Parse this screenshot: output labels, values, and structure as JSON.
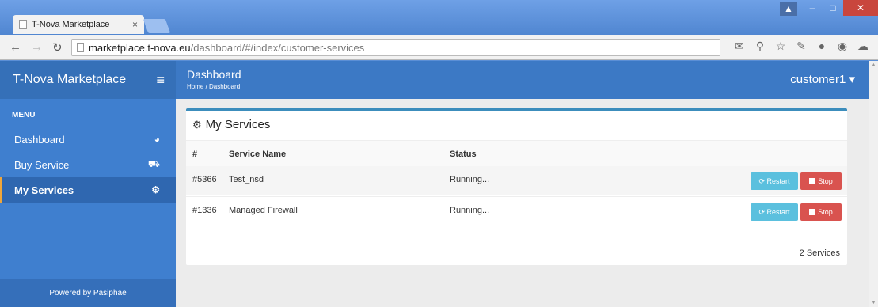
{
  "browser": {
    "tab_title": "T-Nova Marketplace",
    "tab_close": "×",
    "url_host": "marketplace.t-nova.eu",
    "url_path": "/dashboard/#/index/customer-services"
  },
  "app": {
    "brand": "T-Nova Marketplace",
    "header_title": "Dashboard",
    "breadcrumb": "Home / Dashboard",
    "user": "customer1 ▾"
  },
  "sidebar": {
    "menu_header": "MENU",
    "items": [
      {
        "label": "Dashboard",
        "icon": "dashboard-icon"
      },
      {
        "label": "Buy Service",
        "icon": "cart-icon"
      },
      {
        "label": "My Services",
        "icon": "gears-icon"
      }
    ],
    "powered_by": "Powered by Pasiphae"
  },
  "services": {
    "title": "My Services",
    "columns": [
      "#",
      "Service Name",
      "Status"
    ],
    "rows": [
      {
        "id": "#5366",
        "name": "Test_nsd",
        "status": "Running..."
      },
      {
        "id": "#1336",
        "name": "Managed Firewall",
        "status": "Running..."
      }
    ],
    "restart_label": "Restart",
    "stop_label": "Stop",
    "count": "2 Services"
  },
  "colors": {
    "header": "#3c79c5",
    "sidebar": "#3f7fcf",
    "active_accent": "#f0a63a",
    "restart": "#5bc0de",
    "stop": "#d9534f"
  }
}
